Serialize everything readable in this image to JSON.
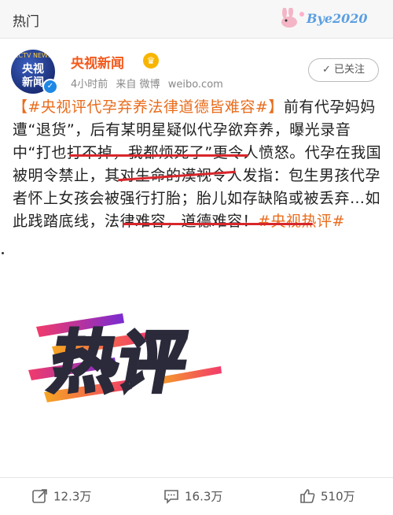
{
  "topbar": {
    "title": "热门",
    "watermark": "Bye2020"
  },
  "account": {
    "avatar_top": "CCTV NEWS",
    "avatar_line1": "央视",
    "avatar_line2": "新闻",
    "name": "央视新闻",
    "time": "4小时前",
    "source": "来自 微博",
    "domain": "weibo.com",
    "follow_label": "已关注"
  },
  "post": {
    "tag_open": "【#央视评代孕弃养法律道德皆难容#】",
    "p1": "前有代孕妈妈遭“退货”，后有某明星疑似代孕欲弃养，曝光录音中",
    "q1": "“打也打不掉，我都烦死了”",
    "p2": "更令人愤怒。代孕在我国被明令禁止，其对生命的漠视令人发指：包生男孩代孕者怀上女孩会被强行打胎；胎儿如存缺陷或被丢弃…如此",
    "q2": "践踏底线，法律难容，道德难容！",
    "tag_close": "#央视热评#"
  },
  "graphic": {
    "text": "热评",
    "colors": [
      "#f23b6b",
      "#7a2bd1",
      "#f5a623"
    ]
  },
  "actions": {
    "repost": "12.3万",
    "comment": "16.3万",
    "like": "510万"
  },
  "colors": {
    "accent": "#f25a1d",
    "link": "#e96c1c",
    "underline": "#d8262b"
  }
}
